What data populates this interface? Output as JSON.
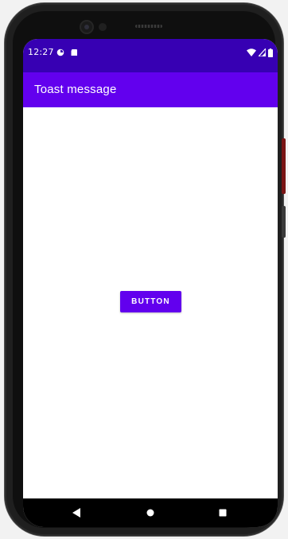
{
  "status_bar": {
    "time": "12:27",
    "left_icons": [
      "sync-icon",
      "sd-card-icon"
    ],
    "right_icons": [
      "wifi-icon",
      "cell-signal-icon",
      "battery-icon"
    ],
    "color": "#3700b3"
  },
  "app_bar": {
    "title": "Toast message",
    "color": "#6200ee"
  },
  "main": {
    "button_label": "BUTTON",
    "button_color": "#6200ee"
  },
  "nav_bar": {
    "items": [
      "back-icon",
      "home-icon",
      "recents-icon"
    ]
  }
}
